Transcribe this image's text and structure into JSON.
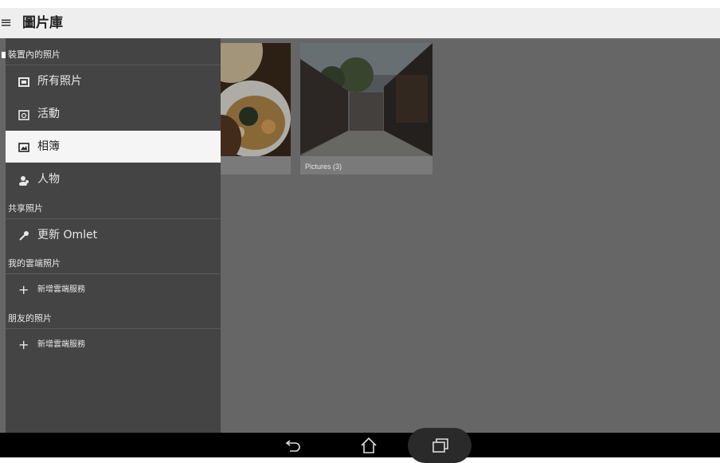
{
  "appbar": {
    "title": "圖片庫",
    "menu_icon": "≡"
  },
  "drawer": {
    "sections": [
      {
        "label": "裝置內的照片"
      },
      {
        "label": "共享照片"
      },
      {
        "label": "我的雲端照片"
      },
      {
        "label": "朋友的照片"
      }
    ],
    "items": [
      {
        "label": "所有照片",
        "icon": "photos-icon"
      },
      {
        "label": "活動",
        "icon": "calendar-icon"
      },
      {
        "label": "相簿",
        "icon": "album-icon",
        "selected": true
      },
      {
        "label": "人物",
        "icon": "people-icon"
      },
      {
        "label": "更新 Omlet",
        "icon": "wrench-icon"
      },
      {
        "label": "新增雲端服務",
        "icon": "plus-icon"
      },
      {
        "label": "新增雲端服務",
        "icon": "plus-icon"
      }
    ]
  },
  "albums": [
    {
      "caption": ""
    },
    {
      "caption": "Pictures (3)"
    }
  ],
  "navbar": {
    "buttons": [
      "back-icon",
      "home-icon",
      "recents-icon"
    ]
  }
}
